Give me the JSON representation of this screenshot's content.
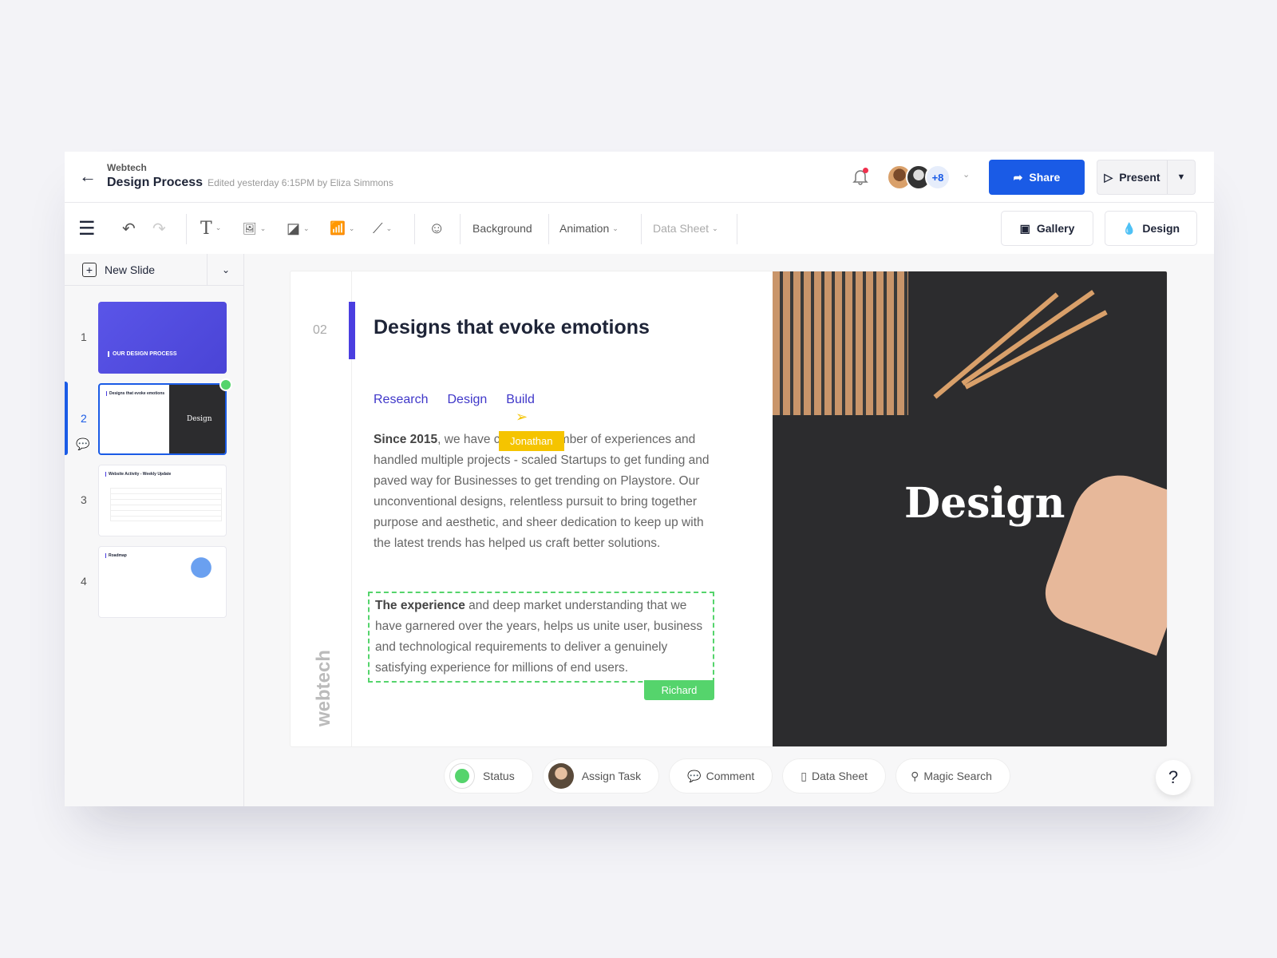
{
  "header": {
    "org": "Webtech",
    "title": "Design Process",
    "edited": "Edited yesterday 6:15PM by Eliza Simmons",
    "collaborators_more": "+8",
    "share_label": "Share",
    "present_label": "Present"
  },
  "toolbar": {
    "background": "Background",
    "animation": "Animation",
    "data_sheet": "Data Sheet",
    "gallery": "Gallery",
    "design": "Design"
  },
  "sidebar": {
    "new_slide": "New Slide",
    "slides": [
      {
        "num": "1",
        "title": "OUR DESIGN PROCESS"
      },
      {
        "num": "2",
        "title": "Designs that evoke emotions",
        "image_word": "Design"
      },
      {
        "num": "3",
        "title": "Website Activity - Weekly Update"
      },
      {
        "num": "4",
        "title": "Roadmap"
      }
    ],
    "active_slide": 2
  },
  "slide": {
    "number": "02",
    "title": "Designs that evoke emotions",
    "tabs": [
      "Research",
      "Design",
      "Build"
    ],
    "para1_bold": "Since 2015",
    "para1": ", we have crafted a number of experiences and handled multiple projects - scaled Startups to get funding and paved way for Businesses to get trending on Playstore. Our unconventional designs, relentless pursuit to bring together purpose and aesthetic, and sheer dedication to keep up with the latest trends has helped us craft better solutions.",
    "para2_bold": "The experience",
    "para2": " and deep market understanding that we have garnered over the years, helps us unite user, business and technological requirements to deliver a genuinely satisfying experience for millions of end users.",
    "cursor_user": "Jonathan",
    "edit_user": "Richard",
    "brand": "webtech",
    "image_word": "Design"
  },
  "bottombar": {
    "status": "Status",
    "assign": "Assign Task",
    "comment": "Comment",
    "data_sheet": "Data Sheet",
    "magic_search": "Magic Search",
    "help": "?"
  },
  "colors": {
    "primary": "#1a5be6",
    "accent": "#4a3ee0",
    "jonathan": "#f5c400",
    "richard": "#55d46c",
    "status": "#55d46c",
    "notification": "#f0304d"
  }
}
